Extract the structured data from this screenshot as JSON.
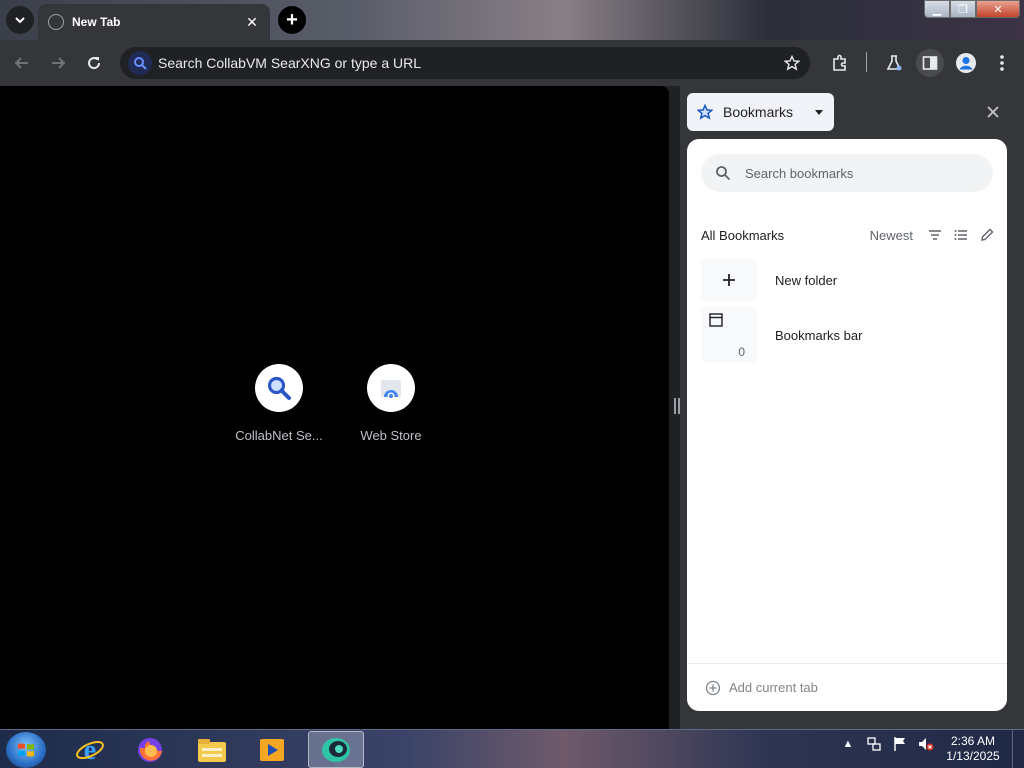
{
  "browser": {
    "tab": {
      "title": "New Tab"
    },
    "omnibox": {
      "placeholder": "Search CollabVM SearXNG or type a URL"
    }
  },
  "new_tab_page": {
    "shortcuts": [
      {
        "label": "CollabNet Se...",
        "icon": "search-icon"
      },
      {
        "label": "Web Store",
        "icon": "web-store-icon"
      }
    ]
  },
  "side_panel": {
    "selector_label": "Bookmarks",
    "search_placeholder": "Search bookmarks",
    "section_title": "All Bookmarks",
    "sort_label": "Newest",
    "items": [
      {
        "label": "New folder",
        "icon": "plus-icon"
      },
      {
        "label": "Bookmarks bar",
        "icon": "folder-icon",
        "count": "0"
      }
    ],
    "footer_label": "Add current tab"
  },
  "taskbar": {
    "clock": {
      "time": "2:36 AM",
      "date": "1/13/2025"
    },
    "apps": [
      "internet-explorer-icon",
      "firefox-icon",
      "file-explorer-icon",
      "media-player-icon",
      "chrome-icon"
    ]
  },
  "colors": {
    "toolbar": "#35363a",
    "content_bg": "#000000",
    "accent_blue": "#1a73e8"
  }
}
